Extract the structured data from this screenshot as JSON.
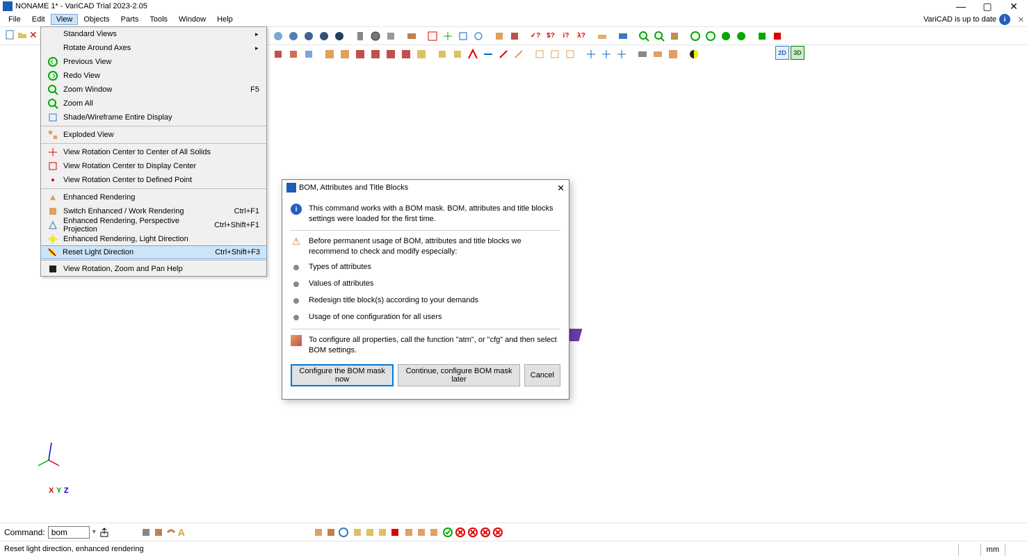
{
  "titlebar": {
    "title": "NONAME 1* - VariCAD Trial 2023-2.05"
  },
  "menubar": {
    "items": [
      "File",
      "Edit",
      "View",
      "Objects",
      "Parts",
      "Tools",
      "Window",
      "Help"
    ],
    "active_index": 2,
    "status_text": "VariCAD is up to date"
  },
  "view_menu": {
    "groups": [
      [
        {
          "label": "Standard Views",
          "submenu": true
        },
        {
          "label": "Rotate Around Axes",
          "submenu": true
        },
        {
          "label": "Previous View"
        },
        {
          "label": "Redo View"
        },
        {
          "label": "Zoom Window",
          "accel": "F5"
        },
        {
          "label": "Zoom All"
        },
        {
          "label": "Shade/Wireframe Entire Display"
        }
      ],
      [
        {
          "label": "Exploded View"
        }
      ],
      [
        {
          "label": "View Rotation Center to Center of All Solids"
        },
        {
          "label": "View Rotation Center to Display Center"
        },
        {
          "label": "View Rotation Center to Defined Point"
        }
      ],
      [
        {
          "label": "Enhanced Rendering"
        },
        {
          "label": "Switch Enhanced / Work Rendering",
          "accel": "Ctrl+F1"
        },
        {
          "label": "Enhanced Rendering, Perspective Projection",
          "accel": "Ctrl+Shift+F1"
        },
        {
          "label": "Enhanced Rendering, Light Direction"
        },
        {
          "label": "Reset Light Direction",
          "accel": "Ctrl+Shift+F3",
          "hover": true
        }
      ],
      [
        {
          "label": "View Rotation, Zoom and Pan Help"
        }
      ]
    ]
  },
  "dialog": {
    "title": "BOM, Attributes and Title Blocks",
    "intro": "This command works with a BOM mask. BOM, attributes and title blocks settings were loaded for the first time.",
    "recommend": "Before permanent usage of BOM, attributes and title blocks we recommend to check and modify especially:",
    "bullets": [
      "Types of attributes",
      "Values of attributes",
      "Redesign title block(s) according to your demands",
      "Usage of one configuration for all users"
    ],
    "footer": "To configure all properties, call the function \"atm\", or \"cfg\" and then select BOM settings.",
    "buttons": {
      "primary": "Configure the BOM mask now",
      "secondary": "Continue, configure BOM mask later",
      "cancel": "Cancel"
    }
  },
  "axis": {
    "x": "X",
    "y": "Y",
    "z": "Z"
  },
  "command_bar": {
    "label": "Command:",
    "value": "bom"
  },
  "status_bar": {
    "text": "Reset light direction, enhanced rendering",
    "unit": "mm"
  },
  "right_badges": {
    "b1": "2D",
    "b2": "3D"
  }
}
